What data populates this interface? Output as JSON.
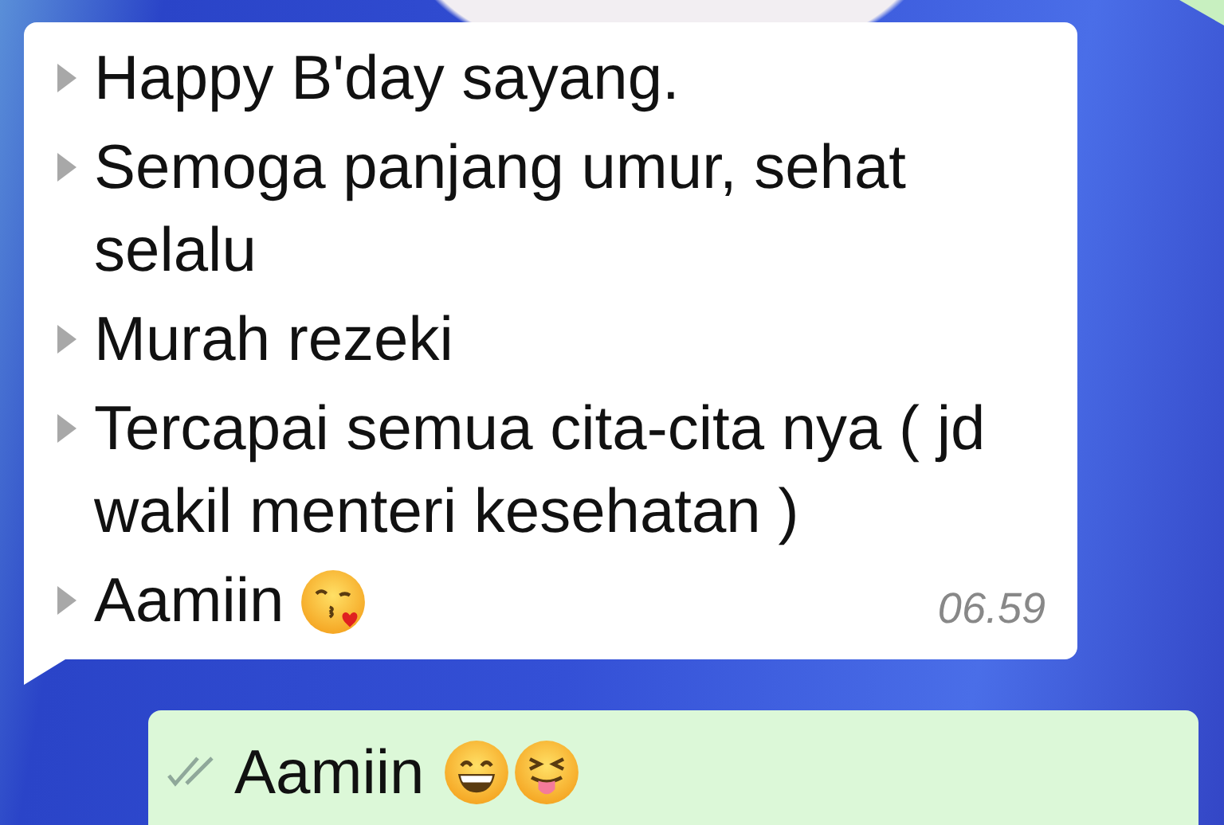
{
  "incoming": {
    "lines": [
      {
        "text": "Happy B'day sayang."
      },
      {
        "text": "Semoga panjang umur, sehat selalu"
      },
      {
        "text": "Murah rezeki"
      },
      {
        "text": "Tercapai semua cita-cita nya  ( jd wakil menteri kesehatan )"
      },
      {
        "text": "Aamiin",
        "emojis": [
          {
            "kind": "kiss"
          }
        ]
      }
    ],
    "time": "06.59"
  },
  "outgoing": {
    "text": "Aamiin",
    "emojis": [
      {
        "kind": "grin"
      },
      {
        "kind": "tongue"
      }
    ],
    "read": false
  }
}
